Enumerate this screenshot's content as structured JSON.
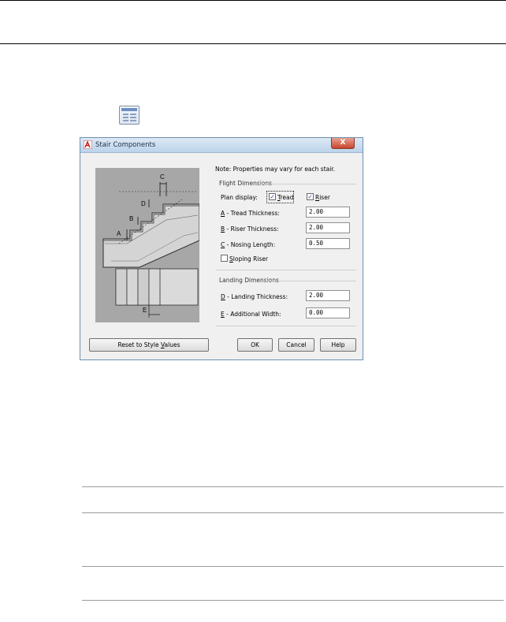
{
  "dialog": {
    "title": "Stair Components",
    "close_label": "X",
    "note": "Note: Properties may vary for each stair.",
    "preview": {
      "labels": {
        "a": "A",
        "b": "B",
        "c": "C",
        "d": "D",
        "e": "E"
      }
    },
    "flight": {
      "heading": "Flight Dimensions",
      "plan_display_label": "Plan display:",
      "tread": {
        "key": "T",
        "rest": "read",
        "checked": true
      },
      "riser": {
        "key": "R",
        "rest": "iser",
        "checked": true
      },
      "tread_thickness": {
        "key": "A",
        "rest": " - Tread Thickness:",
        "value": "2.00"
      },
      "riser_thickness": {
        "key": "B",
        "rest": " - Riser Thickness:",
        "value": "2.00"
      },
      "nosing_length": {
        "key": "C",
        "rest": " - Nosing Length:",
        "value": "0.50"
      },
      "sloping_riser": {
        "key": "S",
        "rest": "loping Riser",
        "checked": false
      }
    },
    "landing": {
      "heading": "Landing Dimensions",
      "landing_thickness": {
        "key": "D",
        "rest": " - Landing Thickness:",
        "value": "2.00"
      },
      "additional_width": {
        "key": "E",
        "rest": " - Additional Width:",
        "value": "0.00"
      }
    },
    "buttons": {
      "reset": {
        "pre": "Reset to Style ",
        "key": "V",
        "rest": "alues"
      },
      "ok": "OK",
      "cancel": "Cancel",
      "help": "Help"
    }
  },
  "toolbar_icon": "style-manager-icon"
}
